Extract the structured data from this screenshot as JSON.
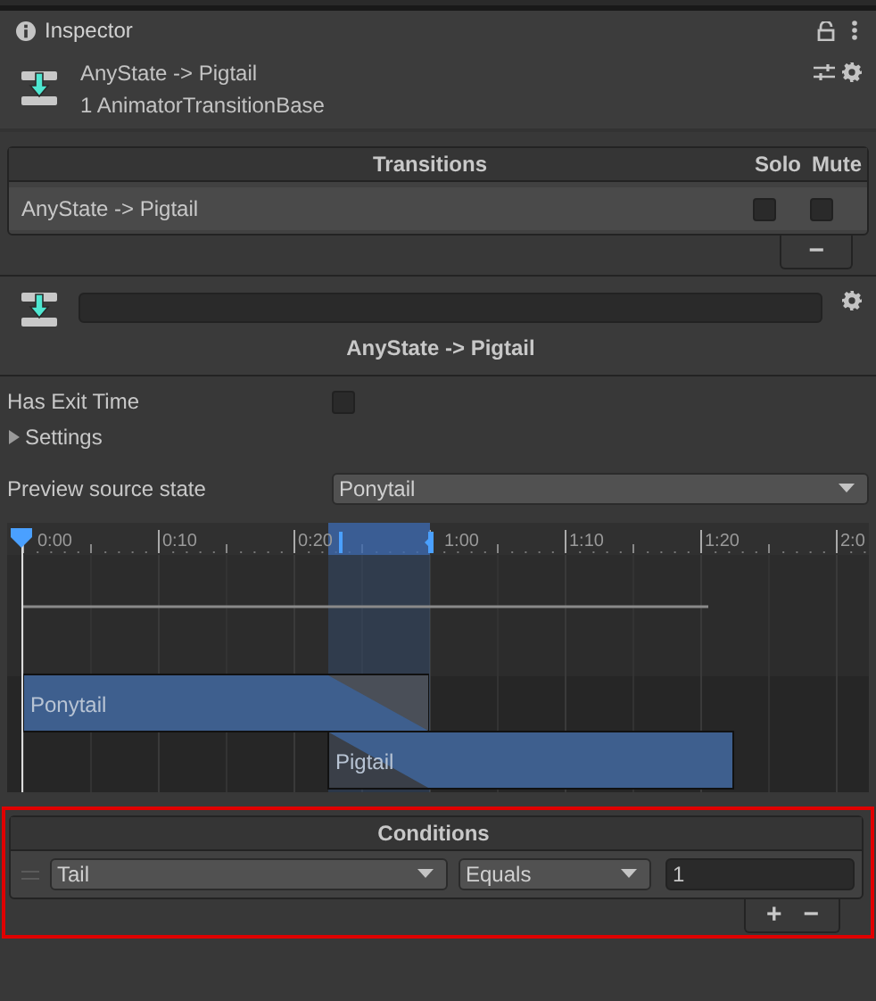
{
  "tab": {
    "label": "Inspector",
    "selected": true
  },
  "header": {
    "title": "AnyState -> Pigtail",
    "subtitle": "1 AnimatorTransitionBase"
  },
  "transitions": {
    "title": "Transitions",
    "columns": [
      "Solo",
      "Mute"
    ],
    "buttons": [
      "−"
    ],
    "rows": [
      {
        "name": "AnyState -> Pigtail",
        "solo": false,
        "mute": false
      }
    ]
  },
  "transition_title": "AnyState -> Pigtail",
  "has_exit_time": {
    "label": "Has Exit Time",
    "checked": false
  },
  "settings": {
    "label": "Settings",
    "expanded": false
  },
  "preview_source": {
    "label": "Preview source state",
    "value": "Ponytail"
  },
  "timeline": {
    "ticks": [
      "0:00",
      "0:10",
      "0:20",
      "1:00",
      "1:10",
      "1:20",
      "2:0"
    ],
    "clips": [
      {
        "name": "Ponytail"
      },
      {
        "name": "Pigtail"
      }
    ]
  },
  "conditions": {
    "title": "Conditions",
    "buttons": [
      "+",
      "−"
    ],
    "rows": [
      {
        "parameter": "Tail",
        "mode": "Equals",
        "value": "1"
      }
    ]
  }
}
